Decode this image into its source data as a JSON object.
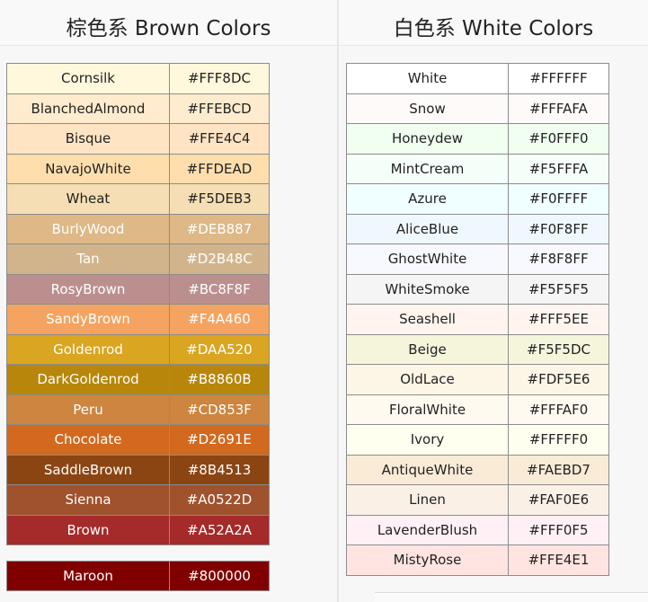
{
  "brown": {
    "title": "棕色系 Brown Colors",
    "colors": [
      {
        "name": "Cornsilk",
        "hex": "#FFF8DC",
        "text": "#222222"
      },
      {
        "name": "BlanchedAlmond",
        "hex": "#FFEBCD",
        "text": "#222222"
      },
      {
        "name": "Bisque",
        "hex": "#FFE4C4",
        "text": "#222222"
      },
      {
        "name": "NavajoWhite",
        "hex": "#FFDEAD",
        "text": "#222222"
      },
      {
        "name": "Wheat",
        "hex": "#F5DEB3",
        "text": "#222222"
      },
      {
        "name": "BurlyWood",
        "hex": "#DEB887",
        "text": "#FFFFFF"
      },
      {
        "name": "Tan",
        "hex": "#D2B48C",
        "text": "#FFFFFF"
      },
      {
        "name": "RosyBrown",
        "hex": "#BC8F8F",
        "text": "#FFFFFF"
      },
      {
        "name": "SandyBrown",
        "hex": "#F4A460",
        "text": "#FFFFFF"
      },
      {
        "name": "Goldenrod",
        "hex": "#DAA520",
        "text": "#FFFFFF"
      },
      {
        "name": "DarkGoldenrod",
        "hex": "#B8860B",
        "text": "#FFFFFF"
      },
      {
        "name": "Peru",
        "hex": "#CD853F",
        "text": "#FFFFFF"
      },
      {
        "name": "Chocolate",
        "hex": "#D2691E",
        "text": "#FFFFFF"
      },
      {
        "name": "SaddleBrown",
        "hex": "#8B4513",
        "text": "#FFFFFF"
      },
      {
        "name": "Sienna",
        "hex": "#A0522D",
        "text": "#FFFFFF"
      },
      {
        "name": "Brown",
        "hex": "#A52A2A",
        "text": "#FFFFFF"
      }
    ],
    "extra": [
      {
        "name": "Maroon",
        "hex": "#800000",
        "text": "#FFFFFF"
      }
    ]
  },
  "white": {
    "title": "白色系 White Colors",
    "colors": [
      {
        "name": "White",
        "hex": "#FFFFFF",
        "text": "#222222"
      },
      {
        "name": "Snow",
        "hex": "#FFFAFA",
        "text": "#222222"
      },
      {
        "name": "Honeydew",
        "hex": "#F0FFF0",
        "text": "#222222"
      },
      {
        "name": "MintCream",
        "hex": "#F5FFFA",
        "text": "#222222"
      },
      {
        "name": "Azure",
        "hex": "#F0FFFF",
        "text": "#222222"
      },
      {
        "name": "AliceBlue",
        "hex": "#F0F8FF",
        "text": "#222222"
      },
      {
        "name": "GhostWhite",
        "hex": "#F8F8FF",
        "text": "#222222"
      },
      {
        "name": "WhiteSmoke",
        "hex": "#F5F5F5",
        "text": "#222222"
      },
      {
        "name": "Seashell",
        "hex": "#FFF5EE",
        "text": "#222222"
      },
      {
        "name": "Beige",
        "hex": "#F5F5DC",
        "text": "#222222"
      },
      {
        "name": "OldLace",
        "hex": "#FDF5E6",
        "text": "#222222"
      },
      {
        "name": "FloralWhite",
        "hex": "#FFFAF0",
        "text": "#222222"
      },
      {
        "name": "Ivory",
        "hex": "#FFFFF0",
        "text": "#222222"
      },
      {
        "name": "AntiqueWhite",
        "hex": "#FAEBD7",
        "text": "#222222"
      },
      {
        "name": "Linen",
        "hex": "#FAF0E6",
        "text": "#222222"
      },
      {
        "name": "LavenderBlush",
        "hex": "#FFF0F5",
        "text": "#222222"
      },
      {
        "name": "MistyRose",
        "hex": "#FFE4E1",
        "text": "#222222"
      }
    ]
  }
}
